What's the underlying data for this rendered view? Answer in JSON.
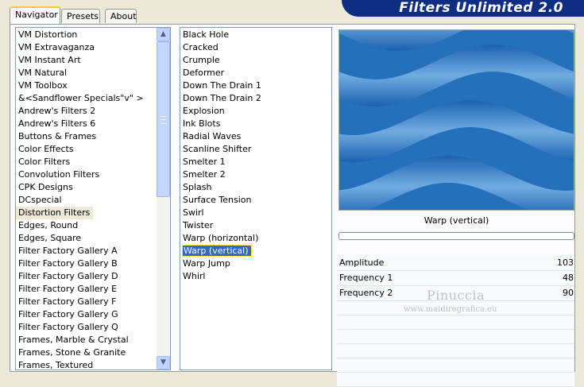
{
  "app_title": "Filters Unlimited 2.0",
  "tabs": [
    {
      "label": "Navigator",
      "active": true
    },
    {
      "label": "Presets",
      "active": false
    },
    {
      "label": "About",
      "active": false
    }
  ],
  "categories": {
    "selected": "Distortion Filters",
    "items": [
      "VM Distortion",
      "VM Extravaganza",
      "VM Instant Art",
      "VM Natural",
      "VM Toolbox",
      "&<Sandflower Specials\"v\" >",
      "Andrew's Filters 2",
      "Andrew's Filters 6",
      "Buttons & Frames",
      "Color Effects",
      "Color Filters",
      "Convolution Filters",
      "CPK Designs",
      "DCspecial",
      "Distortion Filters",
      "Edges, Round",
      "Edges, Square",
      "Filter Factory Gallery A",
      "Filter Factory Gallery B",
      "Filter Factory Gallery D",
      "Filter Factory Gallery E",
      "Filter Factory Gallery F",
      "Filter Factory Gallery G",
      "Filter Factory Gallery Q",
      "Frames, Marble & Crystal",
      "Frames, Stone & Granite",
      "Frames, Textured"
    ]
  },
  "filters": {
    "selected": "Warp (vertical)",
    "items": [
      "Black Hole",
      "Cracked",
      "Crumple",
      "Deformer",
      "Down The Drain 1",
      "Down The Drain 2",
      "Explosion",
      "Ink Blots",
      "Radial Waves",
      "Scanline Shifter",
      "Smelter 1",
      "Smelter 2",
      "Splash",
      "Surface Tension",
      "Swirl",
      "Twister",
      "Warp (horizontal)",
      "Warp (vertical)",
      "Warp Jump",
      "Whirl"
    ]
  },
  "preview": {
    "label": "Warp (vertical)",
    "progress": 0
  },
  "parameters": [
    {
      "name": "Amplitude",
      "value": "103"
    },
    {
      "name": "Frequency 1",
      "value": "48"
    },
    {
      "name": "Frequency 2",
      "value": "90"
    }
  ],
  "watermark": {
    "name": "Pinuccia",
    "url": "www.maidiregrafica.eu"
  },
  "colors": {
    "selection": "#316ac5",
    "banner": "#0f2e83",
    "preview_light": "#7fb6e8",
    "preview_dark": "#1a5fae"
  }
}
